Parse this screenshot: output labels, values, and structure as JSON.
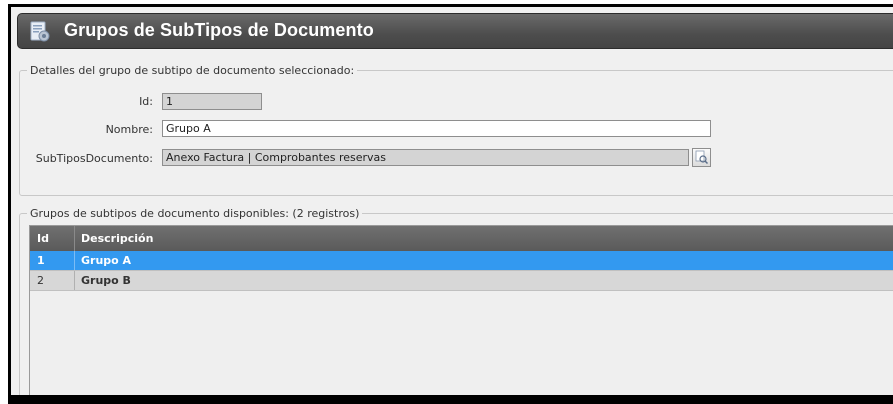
{
  "window": {
    "title": "Grupos de SubTipos de Documento",
    "icon": "document-gear-icon"
  },
  "details": {
    "legend": "Detalles del grupo de subtipo de documento seleccionado:",
    "id_label": "Id:",
    "id_value": "1",
    "nombre_label": "Nombre:",
    "nombre_value": "Grupo A",
    "subtipos_label": "SubTiposDocumento:",
    "subtipos_value": "Anexo Factura | Comprobantes reservas",
    "picker_icon": "search-list-icon"
  },
  "list": {
    "legend": "Grupos de subtipos de documento disponibles:  (2 registros)",
    "columns": [
      "Id",
      "Descripción"
    ],
    "rows": [
      {
        "id": "1",
        "descripcion": "Grupo A",
        "selected": true
      },
      {
        "id": "2",
        "descripcion": "Grupo B",
        "selected": false
      }
    ]
  },
  "colors": {
    "titlebar": "#555555",
    "selection": "#3399f0",
    "grid_header": "#636363"
  }
}
